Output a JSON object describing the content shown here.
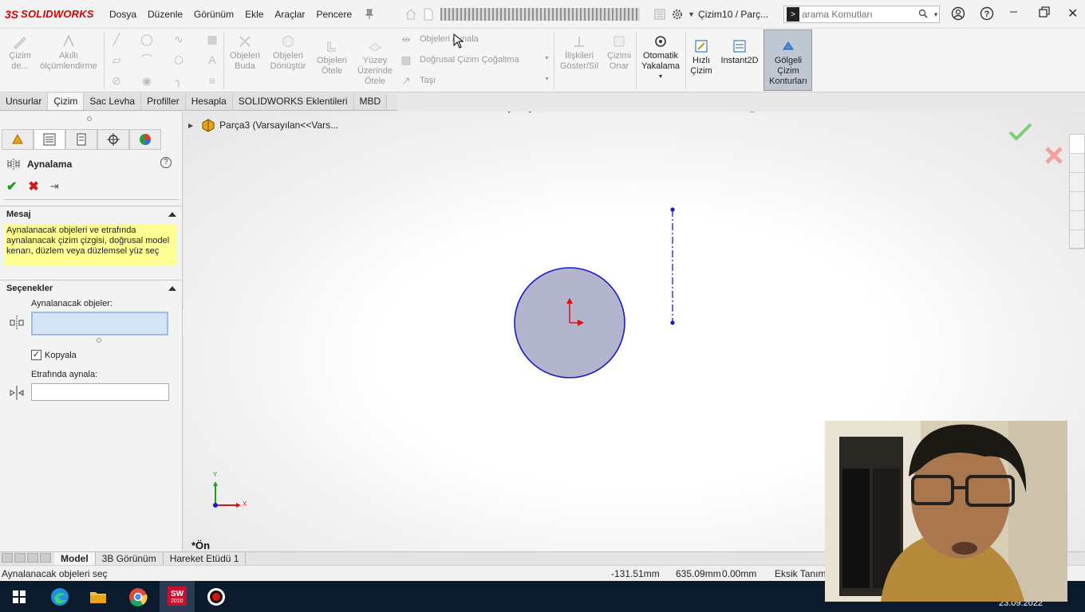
{
  "app": {
    "logo_ds": "3S",
    "logo_text": "SOLIDWORKS",
    "doc_title": "Çizim10 / Parç...",
    "search_placeholder": "arama Komutları"
  },
  "menu": [
    "Dosya",
    "Düzenle",
    "Görünüm",
    "Ekle",
    "Araçlar",
    "Pencere"
  ],
  "ribbon": {
    "cizim_de": "Çizim\nde...",
    "akilli": "Akıllı\nölçümlendirme",
    "objeleri_buda": "Objeleri\nBuda",
    "objeleri_donustur": "Objeleri\nDönüştür",
    "objeleri_otele": "Objeleri\nÖtele",
    "yuzey_uzerinde_otele": "Yüzey\nÜzerinde\nÖtele",
    "objeleri_aynala": "Objeleri Aynala",
    "dogrusal_cogaltma": "Doğrusal Çizim Çoğaltma",
    "tasi": "Taşı",
    "iliskileri": "İlişkileri\nGöster/Sil",
    "cizimi_onar": "Çizimi\nOnar",
    "otomatik_yakalama": "Otomatik\nYakalama",
    "hizli_cizim": "Hızlı\nÇizim",
    "instant2d": "Instant2D",
    "golgeli": "Gölgeli\nÇizim\nKonturları"
  },
  "tabs": [
    {
      "label": "Unsurlar",
      "active": false
    },
    {
      "label": "Çizim",
      "active": true
    },
    {
      "label": "Sac Levha",
      "active": false
    },
    {
      "label": "Profiller",
      "active": false
    },
    {
      "label": "Hesapla",
      "active": false
    },
    {
      "label": "SOLIDWORKS Eklentileri",
      "active": false
    },
    {
      "label": "MBD",
      "active": false
    }
  ],
  "panel": {
    "title": "Aynalama",
    "help": "?",
    "message_header": "Mesaj",
    "message": "Aynalanacak objeleri ve etrafında aynalanacak çizim çizgisi, doğrusal model kenarı, düzlem veya düzlemsel yüz seç",
    "options_header": "Seçenekler",
    "entities_label": "Aynalanacak objeler:",
    "copy_label": "Kopyala",
    "copy_checked": true,
    "mirror_about_label": "Etrafında aynala:"
  },
  "viewport": {
    "tree_label": "Parça3  (Varsayılan<<Vars...",
    "view_name": "*Ön",
    "axis_x": "X",
    "axis_y": "Y"
  },
  "bottom_tabs": [
    {
      "label": "Model",
      "active": true
    },
    {
      "label": "3B Görünüm",
      "active": false
    },
    {
      "label": "Hareket Etüdü 1",
      "active": false
    }
  ],
  "status": {
    "prompt": "Aynalanacak objeleri seç",
    "x": "-131.51mm",
    "y": "635.09mm",
    "z": "0.00mm",
    "state": "Eksik Tanımlı"
  },
  "taskbar": {
    "sw_label": "2020",
    "date": "23.09.2022"
  },
  "colors": {
    "accent_red": "#d40000",
    "sketch_blue": "#1a1acc",
    "message_yellow": "#ffff94",
    "taskbar": "#0c1a2e"
  }
}
